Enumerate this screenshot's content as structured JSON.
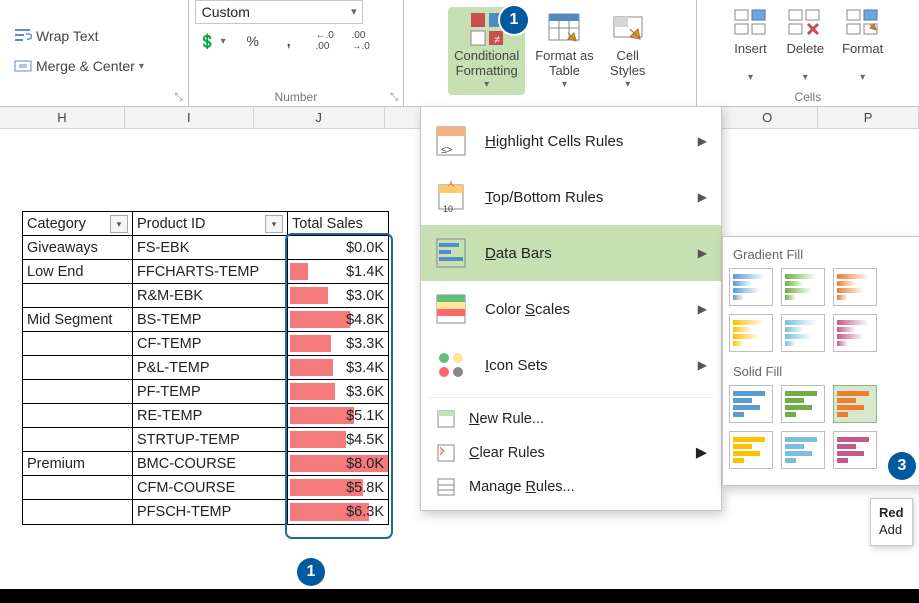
{
  "ribbon": {
    "alignment": {
      "wrap": "Wrap Text",
      "merge": "Merge & Center"
    },
    "number": {
      "format": "Custom",
      "group": "Number"
    },
    "styles": {
      "cf": "Conditional\nFormatting",
      "fat": "Format as\nTable",
      "cs": "Cell\nStyles"
    },
    "cells": {
      "insert": "Insert",
      "delete": "Delete",
      "format": "Format",
      "group": "Cells"
    }
  },
  "columns": [
    "H",
    "I",
    "J",
    "",
    "",
    "",
    "O",
    "P"
  ],
  "table": {
    "headers": {
      "cat": "Category",
      "prod": "Product ID",
      "sales": "Total Sales"
    },
    "rows": [
      {
        "cat": "Giveaways",
        "prod": "FS-EBK",
        "val": "$0.0K",
        "pct": 0
      },
      {
        "cat": "Low End",
        "prod": "FFCHARTS-TEMP",
        "val": "$1.4K",
        "pct": 18
      },
      {
        "cat": "",
        "prod": "R&M-EBK",
        "val": "$3.0K",
        "pct": 38
      },
      {
        "cat": "Mid Segment",
        "prod": "BS-TEMP",
        "val": "$4.8K",
        "pct": 60
      },
      {
        "cat": "",
        "prod": "CF-TEMP",
        "val": "$3.3K",
        "pct": 41
      },
      {
        "cat": "",
        "prod": "P&L-TEMP",
        "val": "$3.4K",
        "pct": 43
      },
      {
        "cat": "",
        "prod": "PF-TEMP",
        "val": "$3.6K",
        "pct": 45
      },
      {
        "cat": "",
        "prod": "RE-TEMP",
        "val": "$5.1K",
        "pct": 64
      },
      {
        "cat": "",
        "prod": "STRTUP-TEMP",
        "val": "$4.5K",
        "pct": 56
      },
      {
        "cat": "Premium",
        "prod": "BMC-COURSE",
        "val": "$8.0K",
        "pct": 100
      },
      {
        "cat": "",
        "prod": "CFM-COURSE",
        "val": "$5.8K",
        "pct": 73
      },
      {
        "cat": "",
        "prod": "PFSCH-TEMP",
        "val": "$6.3K",
        "pct": 79
      }
    ]
  },
  "menu": {
    "items": [
      {
        "label": "Highlight Cells Rules",
        "accel": "H"
      },
      {
        "label": "Top/Bottom Rules",
        "accel": "T"
      },
      {
        "label": "Data Bars",
        "accel": "D",
        "hl": true
      },
      {
        "label": "Color Scales",
        "accel": "S"
      },
      {
        "label": "Icon Sets",
        "accel": "I"
      }
    ],
    "small": [
      {
        "label": "New Rule...",
        "accel": "N"
      },
      {
        "label": "Clear Rules",
        "accel": "C",
        "arrow": true
      },
      {
        "label": "Manage Rules...",
        "accel": "R"
      }
    ]
  },
  "submenu": {
    "grad": "Gradient Fill",
    "solid": "Solid Fill",
    "tip_title": "Red",
    "tip_body": "Add"
  },
  "chart_data": {
    "type": "bar",
    "title": "Total Sales (in-cell data bars)",
    "categories": [
      "FS-EBK",
      "FFCHARTS-TEMP",
      "R&M-EBK",
      "BS-TEMP",
      "CF-TEMP",
      "P&L-TEMP",
      "PF-TEMP",
      "RE-TEMP",
      "STRTUP-TEMP",
      "BMC-COURSE",
      "CFM-COURSE",
      "PFSCH-TEMP"
    ],
    "values": [
      0.0,
      1.4,
      3.0,
      4.8,
      3.3,
      3.4,
      3.6,
      5.1,
      4.5,
      8.0,
      5.8,
      6.3
    ],
    "unit": "Thousand USD",
    "ylim": [
      0,
      8.0
    ]
  }
}
